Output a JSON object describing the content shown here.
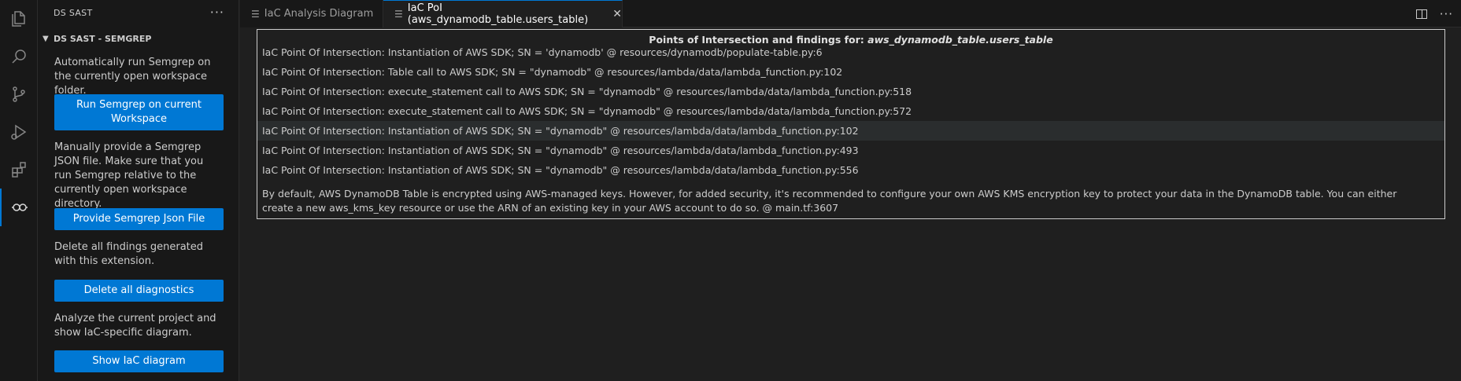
{
  "activity_bar": {
    "icons": [
      "explorer-icon",
      "search-icon",
      "source-control-icon",
      "run-debug-icon",
      "extensions-icon",
      "ds-sast-icon"
    ]
  },
  "sidebar": {
    "title": "DS SAST",
    "more": "···",
    "section_title": "DS SAST - SEMGREP",
    "blocks": [
      {
        "text": "Automatically run Semgrep on the currently open workspace folder.",
        "button": "Run Semgrep on current Workspace"
      },
      {
        "text": "Manually provide a Semgrep JSON file. Make sure that you run Semgrep relative to the currently open workspace directory.",
        "button": "Provide Semgrep Json File"
      },
      {
        "text": "Delete all findings generated with this extension.",
        "button": "Delete all diagnostics"
      },
      {
        "text": "Analyze the current project and show IaC-specific diagram.",
        "button": "Show IaC diagram"
      }
    ]
  },
  "tabs": [
    {
      "label": "IaC Analysis Diagram",
      "active": false
    },
    {
      "label": "IaC PoI (aws_dynamodb_table.users_table)",
      "active": true
    }
  ],
  "panel": {
    "title_prefix": "Points of Intersection and findings for: ",
    "title_resource": "aws_dynamodb_table.users_table",
    "rows": [
      "IaC Point Of Intersection: Instantiation of AWS SDK; SN = 'dynamodb' @ resources/dynamodb/populate-table.py:6",
      "IaC Point Of Intersection: Table call to AWS SDK; SN = \"dynamodb\" @ resources/lambda/data/lambda_function.py:102",
      "IaC Point Of Intersection: execute_statement call to AWS SDK; SN = \"dynamodb\" @ resources/lambda/data/lambda_function.py:518",
      "IaC Point Of Intersection: execute_statement call to AWS SDK; SN = \"dynamodb\" @ resources/lambda/data/lambda_function.py:572",
      "IaC Point Of Intersection: Instantiation of AWS SDK; SN = \"dynamodb\" @ resources/lambda/data/lambda_function.py:102",
      "IaC Point Of Intersection: Instantiation of AWS SDK; SN = \"dynamodb\" @ resources/lambda/data/lambda_function.py:493",
      "IaC Point Of Intersection: Instantiation of AWS SDK; SN = \"dynamodb\" @ resources/lambda/data/lambda_function.py:556"
    ],
    "finding": "By default, AWS DynamoDB Table is encrypted using AWS-managed keys. However, for added security, it's recommended to configure your own AWS KMS encryption key to protect your data in the DynamoDB table. You can either create a new aws_kms_key resource or use the ARN of an existing key in your AWS account to do so. @ main.tf:3607"
  },
  "colors": {
    "accent": "#0078d4",
    "background": "#1f1f1f",
    "sidebar": "#181818"
  }
}
